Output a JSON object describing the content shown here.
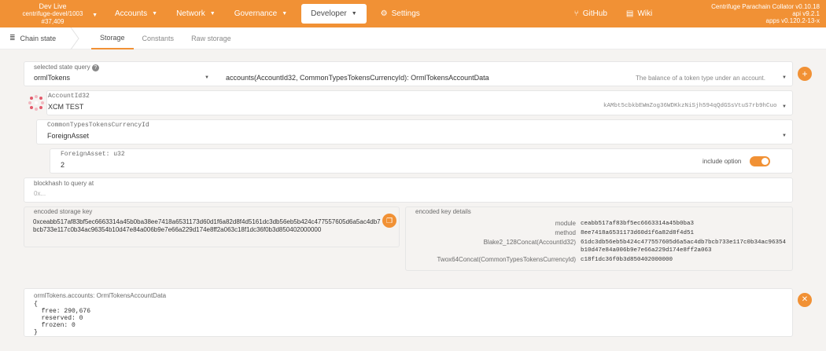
{
  "topbar": {
    "chain_name": "Dev Live",
    "chain_sub": "centrifuge-devel/1003",
    "block": "#37,409",
    "nav": [
      {
        "label": "Accounts"
      },
      {
        "label": "Network"
      },
      {
        "label": "Governance"
      },
      {
        "label": "Developer"
      },
      {
        "label": "Settings"
      },
      {
        "label": "GitHub"
      },
      {
        "label": "Wiki"
      }
    ],
    "right_title": "Centrifuge Parachain Collator v0.10.18",
    "right_api": "api v9.2.1",
    "right_apps": "apps v0.120.2-13-x"
  },
  "subbar": {
    "section": "Chain state",
    "tabs": [
      "Storage",
      "Constants",
      "Raw storage"
    ]
  },
  "query": {
    "label": "selected state query",
    "module": "ormlTokens",
    "method": "accounts(AccountId32, CommonTypesTokensCurrencyId): OrmlTokensAccountData",
    "description": "The balance of a token type under an account."
  },
  "account": {
    "label": "AccountId32",
    "name": "XCM TEST",
    "address": "kAMbt5cbkbEWmZog36WDKkzNiSjh594qQdGSsVtuS7rb9hCuo"
  },
  "currency": {
    "label": "CommonTypesTokensCurrencyId",
    "value": "ForeignAsset"
  },
  "foreign": {
    "label": "ForeignAsset: u32",
    "value": "2",
    "include_label": "include option"
  },
  "blockhash": {
    "label": "blockhash to query at",
    "placeholder": "0x..."
  },
  "encoded": {
    "label": "encoded storage key",
    "value": "0xceabb517af83bf5ec6663314a45b0ba38ee7418a6531173d60d1f6a82d8f4d5161dc3db56eb5b424c477557605d6a5ac4db7bcb733e117c0b34ac96354b10d47e84a006b9e7e66a229d174e8ff2a063c18f1dc36f0b3d850402000000"
  },
  "details": {
    "label": "encoded key details",
    "rows": [
      {
        "k": "module",
        "v": "ceabb517af83bf5ec6663314a45b0ba3"
      },
      {
        "k": "method",
        "v": "8ee7418a6531173d60d1f6a82d8f4d51"
      },
      {
        "k": "Blake2_128Concat(AccountId32)",
        "v": "61dc3db56eb5b424c477557605d6a5ac4db7bcb733e117c0b34ac96354b10d47e84a006b9e7e66a229d174e8ff2a063"
      },
      {
        "k": "Twox64Concat(CommonTypesTokensCurrencyId)",
        "v": "c18f1dc36f0b3d850402000000"
      }
    ]
  },
  "result": {
    "label": "ormlTokens.accounts: OrmlTokensAccountData",
    "body": "{\n  free: 290,676\n  reserved: 0\n  frozen: 0\n}"
  },
  "colors": {
    "accent": "#f19135"
  }
}
